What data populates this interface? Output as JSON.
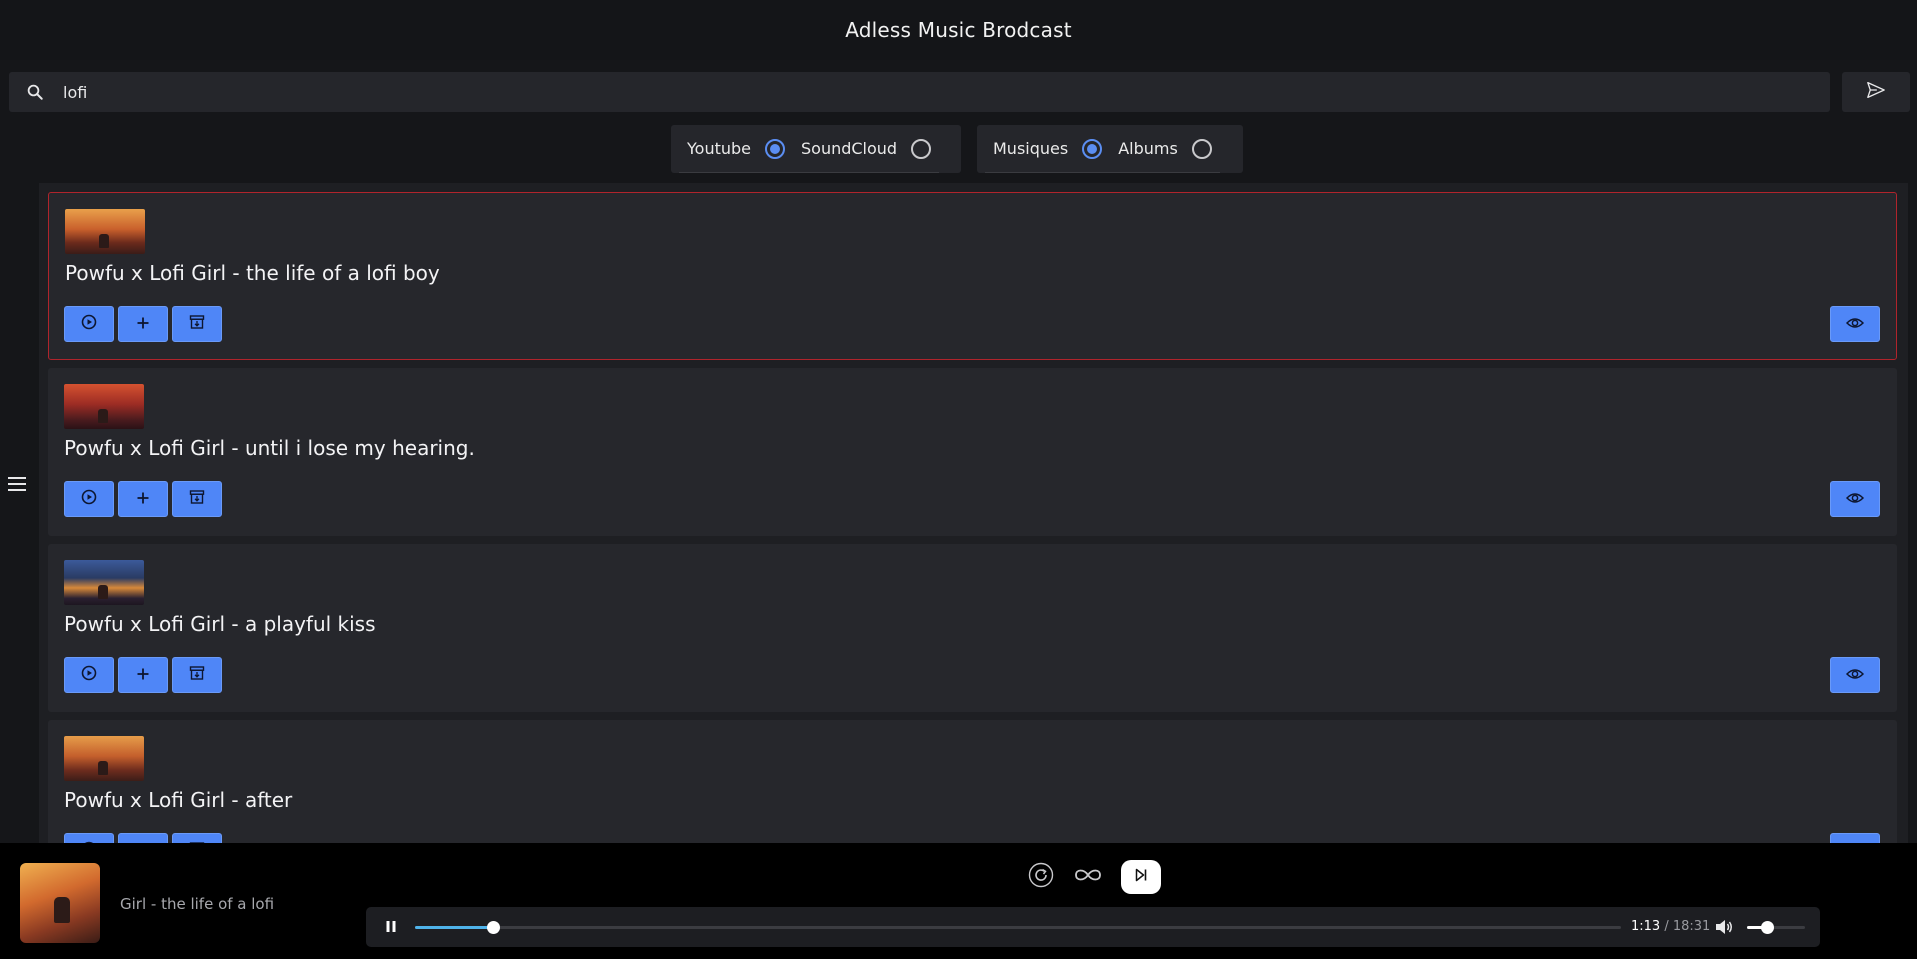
{
  "app": {
    "title": "Adless Music Brodcast"
  },
  "search": {
    "value": "lofi",
    "search_icon": "search-icon",
    "send_icon": "send-icon"
  },
  "filters": {
    "source": [
      {
        "label": "Youtube",
        "checked": true
      },
      {
        "label": "SoundCloud",
        "checked": false
      }
    ],
    "type": [
      {
        "label": "Musiques",
        "checked": true
      },
      {
        "label": "Albums",
        "checked": false
      }
    ]
  },
  "results": [
    {
      "title": "Powfu x Lofi Girl - the life of a lofi boy",
      "selected": true
    },
    {
      "title": "Powfu x Lofi Girl - until i lose my hearing.",
      "selected": false
    },
    {
      "title": "Powfu x Lofi Girl - a playful kiss",
      "selected": false
    },
    {
      "title": "Powfu x Lofi Girl - after",
      "selected": false
    }
  ],
  "card_actions": [
    "play-icon",
    "add-icon",
    "archive-download-icon",
    "eye-icon"
  ],
  "player": {
    "now_playing": "Girl - the life of a lofi l",
    "current_time": "1:13",
    "separator": " / ",
    "duration": "18:31",
    "progress": 0.065,
    "volume": 0.35,
    "controls": [
      "replay-icon",
      "infinite-loop-icon",
      "skip-next-icon",
      "pause-icon",
      "volume-icon"
    ]
  },
  "colors": {
    "accent": "#4f86f7",
    "radio_checked": "#5b8ef2",
    "progress": "#4fb3ea",
    "selected_border": "#b0242c",
    "background": "#151619",
    "card": "#26272c"
  }
}
